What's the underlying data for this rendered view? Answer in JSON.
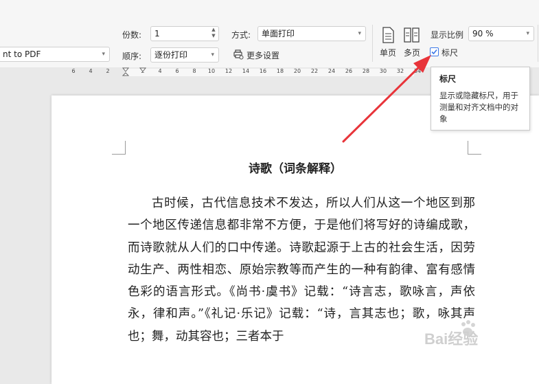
{
  "toolbar": {
    "printer_value": "nt to PDF",
    "copies_label": "份数:",
    "copies_value": "1",
    "order_label": "顺序:",
    "order_value": "逐份打印",
    "mode_label": "方式:",
    "mode_value": "单面打印",
    "more_settings_label": "更多设置",
    "single_page_label": "单页",
    "multi_page_label": "多页",
    "zoom_label": "显示比例",
    "zoom_value": "90 %",
    "ruler_label": "标尺",
    "ruler_checked": true
  },
  "ruler": {
    "left_ticks": [
      "6",
      "4",
      "2"
    ],
    "right_ticks": [
      "2",
      "4",
      "6",
      "8",
      "10",
      "12",
      "14",
      "16",
      "18",
      "20",
      "22",
      "24",
      "26",
      "28",
      "30",
      "32",
      "34"
    ]
  },
  "tooltip": {
    "title": "标尺",
    "text": "显示或隐藏标尺，用于测量和对齐文档中的对象"
  },
  "document": {
    "title": "诗歌（词条解释）",
    "body": "古时候，古代信息技术不发达，所以人们从这一个地区到那一个地区传递信息都非常不方便，于是他们将写好的诗编成歌，而诗歌就从人们的口中传递。诗歌起源于上古的社会生活，因劳动生产、两性相恋、原始宗教等而产生的一种有韵律、富有感情色彩的语言形式。《尚书·虞书》记载：“诗言志，歌咏言，声依永，律和声。”《礼记·乐记》记载：“诗，言其志也；歌，咏其声也；舞，动其容也；三者本于"
  },
  "watermark": {
    "text": "Bai经验"
  },
  "colors": {
    "accent": "#3b78e7",
    "arrow": "#e8343a"
  }
}
